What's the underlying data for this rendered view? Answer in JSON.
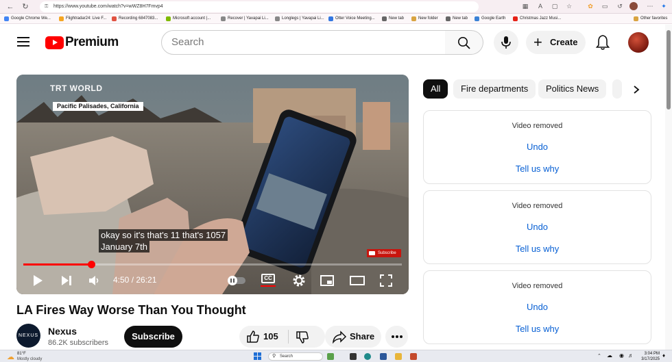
{
  "browser": {
    "url": "https://www.youtube.com/watch?v=wWZ8H7Fmvp4",
    "bookmarks": [
      {
        "label": "Google Chrome We...",
        "color": "#4285f4"
      },
      {
        "label": "Flightradar24: Live F...",
        "color": "#f5a623"
      },
      {
        "label": "Recording 6847083...",
        "color": "#e15241"
      },
      {
        "label": "Microsoft account |...",
        "color": "#7fba00"
      },
      {
        "label": "Recover | Yavapai Li...",
        "color": "#888888"
      },
      {
        "label": "Longlegs | Yavapai Li...",
        "color": "#888888"
      },
      {
        "label": "Otter Voice Meeting...",
        "color": "#3477e1"
      },
      {
        "label": "New tab",
        "color": "#666666"
      },
      {
        "label": "New folder",
        "color": "#d9a441"
      },
      {
        "label": "New tab",
        "color": "#666666"
      },
      {
        "label": "Google Earth",
        "color": "#3b82d6"
      },
      {
        "label": "Christmas Jazz Musi...",
        "color": "#e62117"
      },
      {
        "label": "Other favorites",
        "color": "#d9a441"
      }
    ]
  },
  "header": {
    "logo_text": "Premium",
    "search_placeholder": "Search",
    "create_label": "Create"
  },
  "player": {
    "watermark": "TRT WORLD",
    "location": "Pacific Palisades, California",
    "caption_lines": [
      "okay so it's that's 11 that's 1057",
      "January 7th"
    ],
    "subscribe_badge": "Subscribe",
    "time": "4:50 / 26:21",
    "progress": 0.18,
    "cc_label": "CC"
  },
  "video": {
    "title": "LA Fires Way Worse Than You Thought",
    "channel": "Nexus",
    "channel_avatar_text": "NEXUS",
    "subscribers": "86.2K subscribers",
    "subscribe_label": "Subscribe",
    "likes": "105",
    "share_label": "Share"
  },
  "chips": {
    "items": [
      "All",
      "Fire departments",
      "Politics News"
    ]
  },
  "removed": [
    {
      "text": "Video removed",
      "undo": "Undo",
      "why": "Tell us why"
    },
    {
      "text": "Video removed",
      "undo": "Undo",
      "why": "Tell us why"
    },
    {
      "text": "Video removed",
      "undo": "Undo",
      "why": "Tell us why"
    }
  ],
  "taskbar": {
    "temperature": "81°F",
    "weather": "Mostly cloudy",
    "search_label": "Search",
    "time": "3:04 PM",
    "date": "3/17/2025"
  },
  "colors": {
    "accent": "#ff0000",
    "link": "#065fd4"
  }
}
